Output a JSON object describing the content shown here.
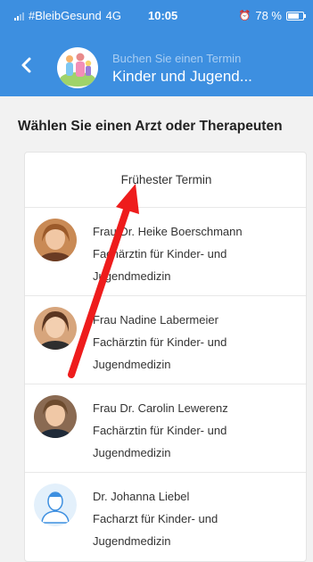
{
  "statusbar": {
    "carrier": "#BleibGesund",
    "network": "4G",
    "time": "10:05",
    "battery": "78 %",
    "battery_level": 0.78
  },
  "header": {
    "back_icon": "chevron-left-icon",
    "subtitle": "Buchen Sie einen Termin",
    "title": "Kinder und Jugend..."
  },
  "section_title": "Wählen Sie einen Arzt oder Therapeuten",
  "earliest_label": "Frühester Termin",
  "doctors": [
    {
      "name": "Frau Dr. Heike Boerschmann",
      "spec1": "Fachärztin für Kinder- und",
      "spec2": "Jugendmedizin"
    },
    {
      "name": "Frau Nadine Labermeier",
      "spec1": "Fachärztin für Kinder- und",
      "spec2": "Jugendmedizin"
    },
    {
      "name": "Frau Dr. Carolin Lewerenz",
      "spec1": "Fachärztin für Kinder- und",
      "spec2": "Jugendmedizin"
    },
    {
      "name": "Dr. Johanna Liebel",
      "spec1": "Facharzt für Kinder- und",
      "spec2": "Jugendmedizin"
    }
  ],
  "colors": {
    "header": "#3d8fe0",
    "arrow": "#ee1c1c"
  }
}
